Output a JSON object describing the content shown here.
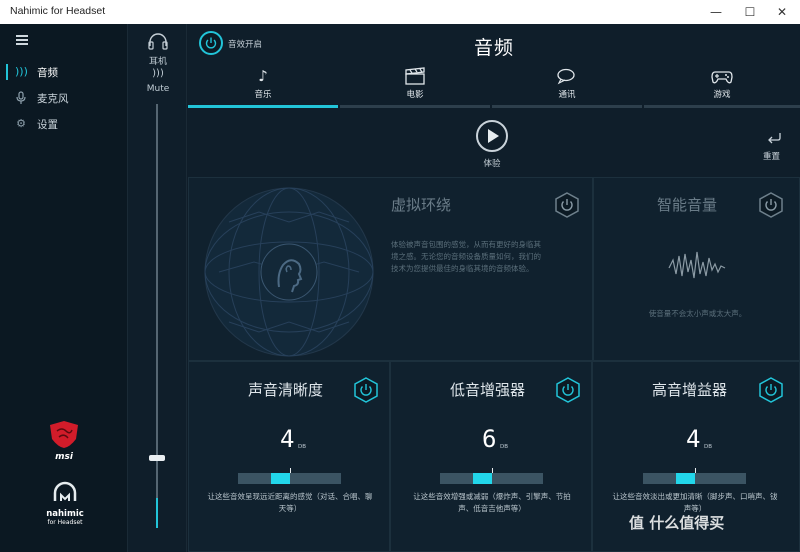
{
  "window": {
    "title": "Nahimic for Headset",
    "minimize": "—",
    "maximize": "☐",
    "close": "✕"
  },
  "sidebar": {
    "items": [
      {
        "label": "音频",
        "icon": "speaker-waves-icon",
        "active": true
      },
      {
        "label": "麦克风",
        "icon": "microphone-icon",
        "active": false
      },
      {
        "label": "设置",
        "icon": "gear-icon",
        "active": false
      }
    ],
    "logo_text": "msi",
    "brand": {
      "name": "nahimic",
      "sub": "for Headset"
    }
  },
  "volume": {
    "device_label": "耳机",
    "mute_label": "Mute",
    "level": 0.15
  },
  "header": {
    "effects_toggle_label": "音效开启",
    "page_title": "音频"
  },
  "tabs": [
    {
      "label": "音乐",
      "icon": "music-note-icon",
      "active": true
    },
    {
      "label": "电影",
      "icon": "clapperboard-icon",
      "active": false
    },
    {
      "label": "通讯",
      "icon": "chat-bubbles-icon",
      "active": false
    },
    {
      "label": "游戏",
      "icon": "gamepad-icon",
      "active": false
    }
  ],
  "toolbar": {
    "experience_label": "体验",
    "reset_label": "重置"
  },
  "surround": {
    "title": "虚拟环绕",
    "desc": "体验被声音包围的感觉，从而有更好的身临其境之感。无论您的音频设备质量如何，我们的技术为您提供最佳的身临其境的音频体验。"
  },
  "smart_volume": {
    "title": "智能音量",
    "desc": "使音量不会太小声或太大声。"
  },
  "effects": [
    {
      "title": "声音清晰度",
      "value": "4",
      "unit": "DB",
      "level": 0.5,
      "desc": "让这些音效呈现远近距离的感觉（对话、合唱、聊天等）"
    },
    {
      "title": "低音增强器",
      "value": "6",
      "unit": "DB",
      "level": 0.5,
      "desc": "让这些音效增强或减弱（爆炸声、引擎声、节拍声、低音吉他声等）"
    },
    {
      "title": "高音增益器",
      "value": "4",
      "unit": "DB",
      "level": 0.5,
      "desc": "让这些音效淡出或更加清晰（脚步声、口哨声、钹声等）"
    }
  ],
  "watermark": "值 什么值得买",
  "colors": {
    "accent": "#22c4d8",
    "background": "#0f1e2a"
  }
}
